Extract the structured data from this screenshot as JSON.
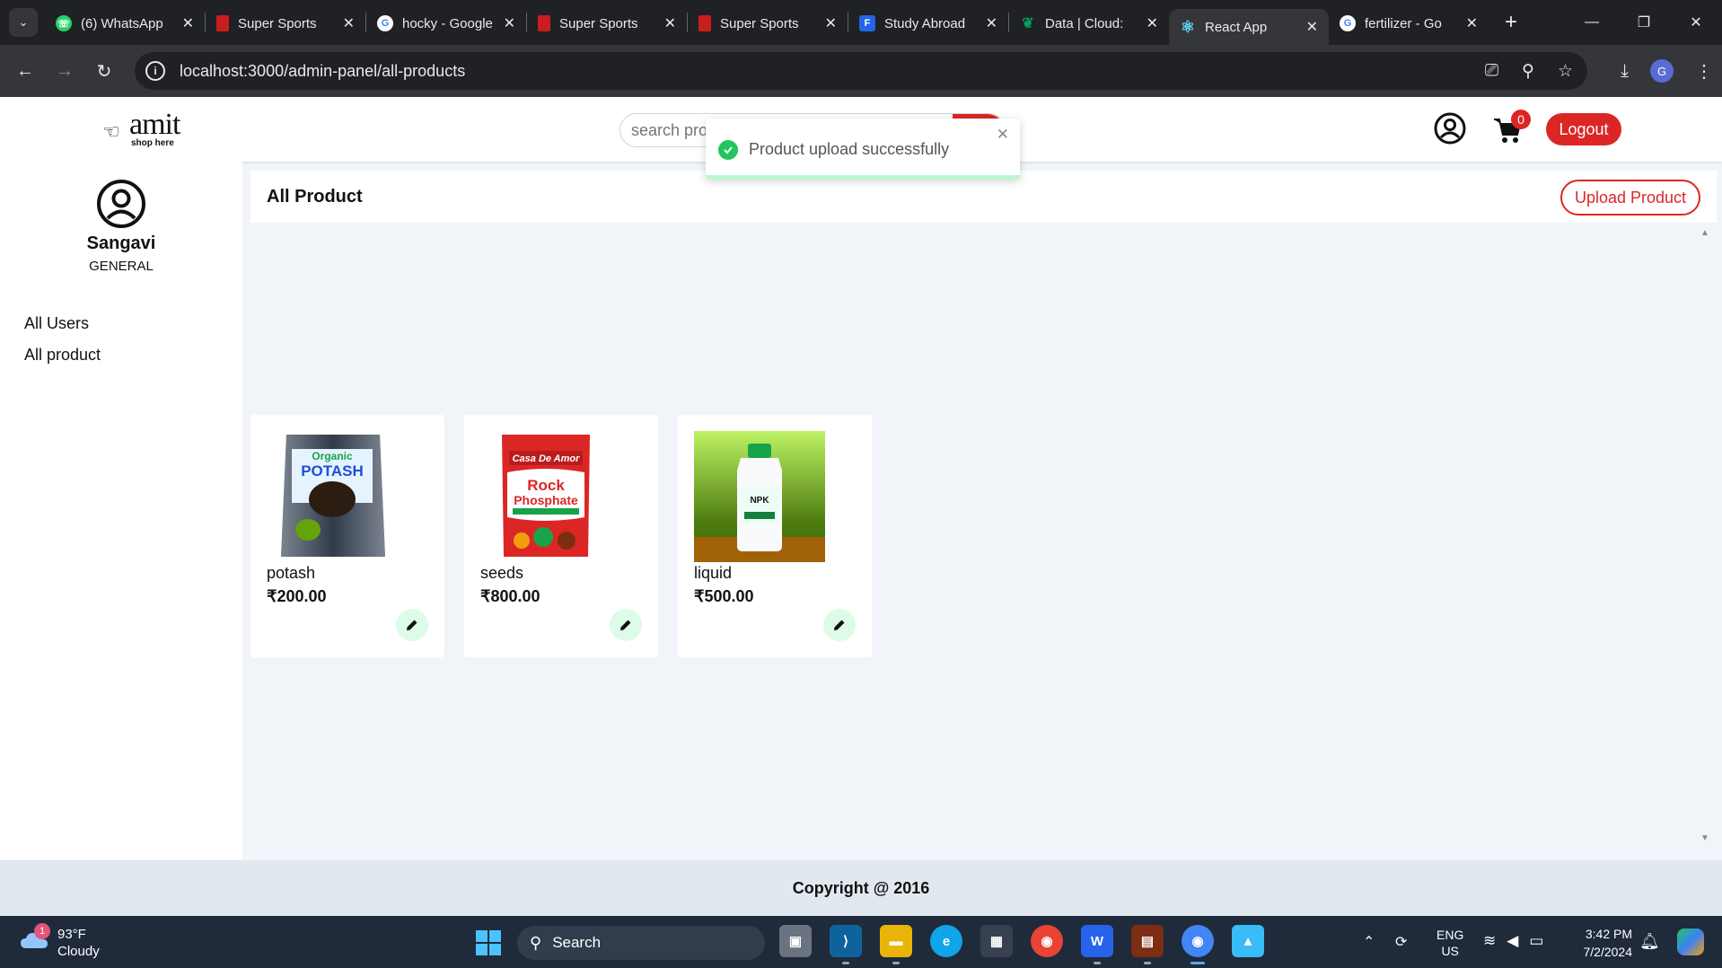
{
  "browser": {
    "tabs": [
      {
        "title": "(6) WhatsApp",
        "favicon": "whatsapp-icon",
        "color": "#25d366"
      },
      {
        "title": "Super Sports",
        "favicon": "super-sports-icon",
        "color": "#c81e1e"
      },
      {
        "title": "hocky - Google",
        "favicon": "google-icon",
        "color": "#4285f4"
      },
      {
        "title": "Super Sports",
        "favicon": "super-sports-icon",
        "color": "#c81e1e"
      },
      {
        "title": "Super Sports",
        "favicon": "super-sports-icon",
        "color": "#c81e1e"
      },
      {
        "title": "Study Abroad",
        "favicon": "forms-icon",
        "color": "#2563eb"
      },
      {
        "title": "Data | Cloud:",
        "favicon": "mongodb-leaf-icon",
        "color": "#00a35c"
      },
      {
        "title": "React App",
        "favicon": "react-icon",
        "color": "#61dafb",
        "active": true
      },
      {
        "title": "fertilizer - Go",
        "favicon": "google-icon",
        "color": "#4285f4"
      }
    ],
    "url": "localhost:3000/admin-panel/all-products",
    "profile_initial": "G"
  },
  "header": {
    "logo_name": "amit",
    "logo_tagline": "shop here",
    "search_placeholder": "search product here...",
    "cart_count": "0",
    "logout_label": "Logout"
  },
  "toast": {
    "message": "Product upload successfully"
  },
  "sidebar": {
    "user_name": "Sangavi",
    "user_role": "GENERAL",
    "items": [
      {
        "label": "All Users"
      },
      {
        "label": "All product"
      }
    ]
  },
  "main": {
    "title": "All Product",
    "upload_label": "Upload Product",
    "products": [
      {
        "name": "potash",
        "price": "₹200.00",
        "image": "potash-bag"
      },
      {
        "name": "seeds",
        "price": "₹800.00",
        "image": "rock-phosphate-bag"
      },
      {
        "name": "liquid",
        "price": "₹500.00",
        "image": "npk-bottle"
      }
    ]
  },
  "footer": {
    "copyright": "Copyright @ 2016"
  },
  "taskbar": {
    "weather_temp": "93°F",
    "weather_condition": "Cloudy",
    "weather_badge": "1",
    "search_label": "Search",
    "lang_top": "ENG",
    "lang_bottom": "US",
    "time": "3:42 PM",
    "date": "7/2/2024"
  },
  "colors": {
    "accent": "#dc2626",
    "success": "#22c55e",
    "page_bg": "#f1f5f9"
  }
}
